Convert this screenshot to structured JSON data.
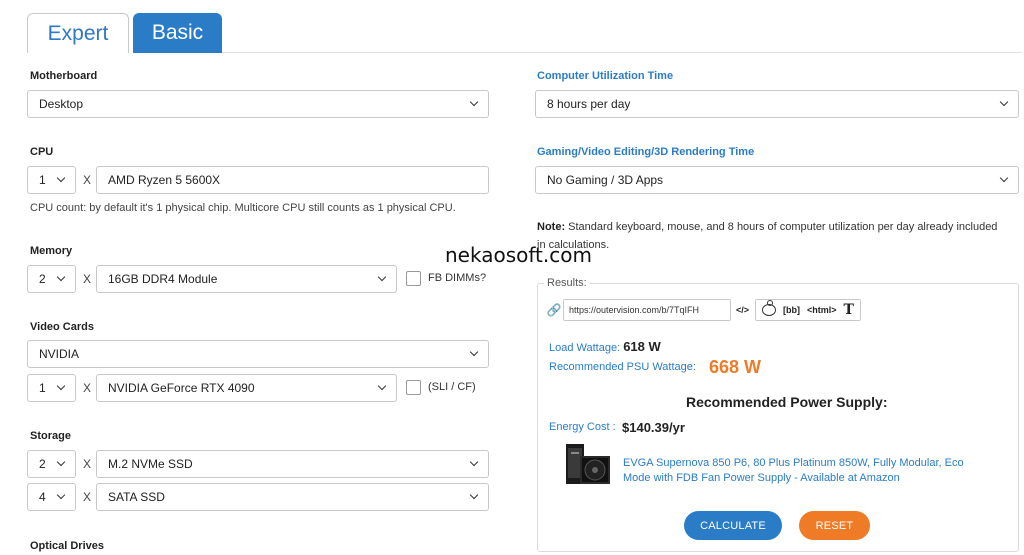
{
  "tabs": {
    "expert": "Expert",
    "basic": "Basic"
  },
  "motherboard": {
    "label": "Motherboard",
    "value": "Desktop"
  },
  "cpu": {
    "label": "CPU",
    "count": "1",
    "x": "X",
    "value": "AMD Ryzen 5 5600X",
    "hint": "CPU count: by default it's 1 physical chip. Multicore CPU still counts as 1 physical CPU."
  },
  "memory": {
    "label": "Memory",
    "count": "2",
    "x": "X",
    "value": "16GB DDR4 Module",
    "checkbox_label": "FB DIMMs?"
  },
  "video": {
    "label": "Video Cards",
    "brand": "NVIDIA",
    "count": "1",
    "x": "X",
    "value": "NVIDIA GeForce RTX 4090",
    "checkbox_label": "(SLI / CF)"
  },
  "storage": {
    "label": "Storage",
    "rows": [
      {
        "count": "2",
        "x": "X",
        "value": "M.2 NVMe SSD"
      },
      {
        "count": "4",
        "x": "X",
        "value": "SATA SSD"
      }
    ]
  },
  "optical": {
    "label": "Optical Drives"
  },
  "utilization": {
    "label": "Computer Utilization Time",
    "value": "8 hours per day"
  },
  "gaming": {
    "label": "Gaming/Video Editing/3D Rendering Time",
    "value": "No Gaming / 3D Apps"
  },
  "note": {
    "prefix": "Note:",
    "text": " Standard keyboard, mouse, and 8 hours of computer utilization per day already included in calculations."
  },
  "watermark": "nekaosoft.com",
  "results": {
    "legend": "Results:",
    "url": "https://outervision.com/b/7TqIFH",
    "share": {
      "embed": "</>",
      "bb": "[bb]",
      "html": "<html>",
      "text": "T"
    },
    "load_label": "Load Wattage:",
    "load_value": "618 W",
    "psu_label": "Recommended PSU Wattage:",
    "psu_value": "668 W",
    "recommended_title": "Recommended Power Supply:",
    "energy_label": "Energy Cost :",
    "energy_value": "$140.39/yr",
    "psu_product": "EVGA Supernova 850 P6, 80 Plus Platinum 850W, Fully Modular, Eco Mode with FDB Fan Power Supply - Available at Amazon"
  },
  "buttons": {
    "calculate": "CALCULATE",
    "reset": "RESET"
  }
}
